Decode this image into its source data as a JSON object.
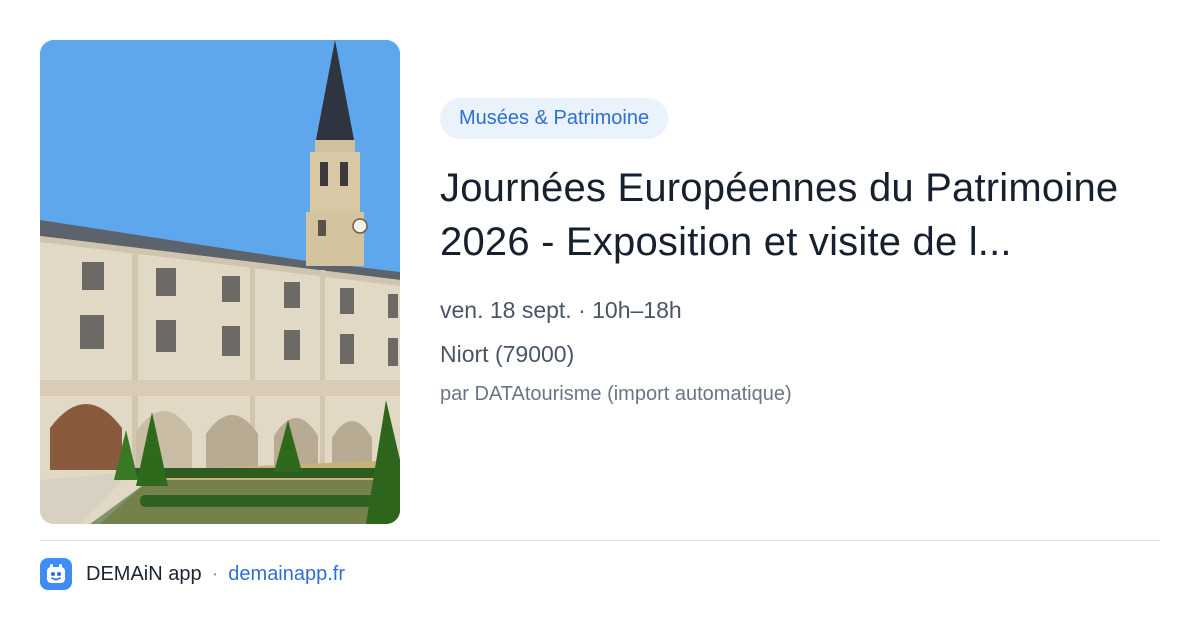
{
  "event": {
    "category": "Musées & Patrimoine",
    "title": "Journées Européennes du Patrimoine 2026 - Exposition et visite de l...",
    "when": "ven. 18 sept. · 10h–18h",
    "where": "Niort (79000)",
    "source": "par DATAtourisme (import automatique)",
    "image_alt": "Bâtiment historique avec clocher et cour à arcades"
  },
  "footer": {
    "app_name": "DEMAiN app",
    "separator": "·",
    "domain": "demainapp.fr",
    "icon": "app-logo-icon"
  },
  "colors": {
    "accent": "#2f6fd1",
    "badge_bg": "#eaf2fc",
    "app_icon_bg": "#3f8df2"
  }
}
